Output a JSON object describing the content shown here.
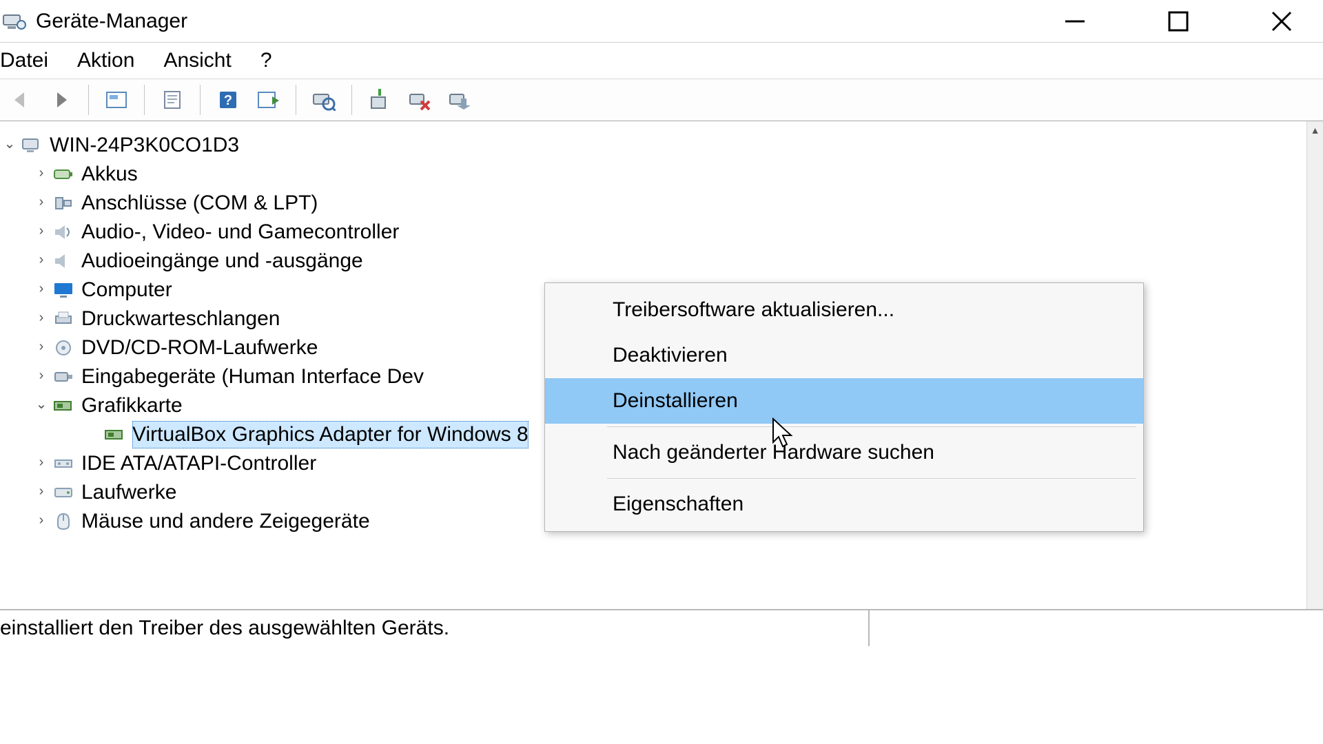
{
  "window": {
    "title": "Geräte-Manager"
  },
  "menu": {
    "file": "Datei",
    "action": "Aktion",
    "view": "Ansicht",
    "help": "?"
  },
  "tree": {
    "root": "WIN-24P3K0CO1D3",
    "items": [
      {
        "label": "Akkus"
      },
      {
        "label": "Anschlüsse (COM & LPT)"
      },
      {
        "label": "Audio-, Video- und Gamecontroller"
      },
      {
        "label": "Audioeingänge und -ausgänge"
      },
      {
        "label": "Computer"
      },
      {
        "label": "Druckwarteschlangen"
      },
      {
        "label": "DVD/CD-ROM-Laufwerke"
      },
      {
        "label": "Eingabegeräte (Human Interface Dev"
      },
      {
        "label": "Grafikkarte"
      },
      {
        "label": "IDE ATA/ATAPI-Controller"
      },
      {
        "label": "Laufwerke"
      },
      {
        "label": "Mäuse und andere Zeigegeräte"
      }
    ],
    "selected_device": "VirtualBox Graphics Adapter for Windows 8"
  },
  "context_menu": {
    "update": "Treibersoftware aktualisieren...",
    "disable": "Deaktivieren",
    "uninstall": "Deinstallieren",
    "scan": "Nach geänderter Hardware suchen",
    "properties": "Eigenschaften"
  },
  "status": "einstalliert den Treiber des ausgewählten Geräts."
}
